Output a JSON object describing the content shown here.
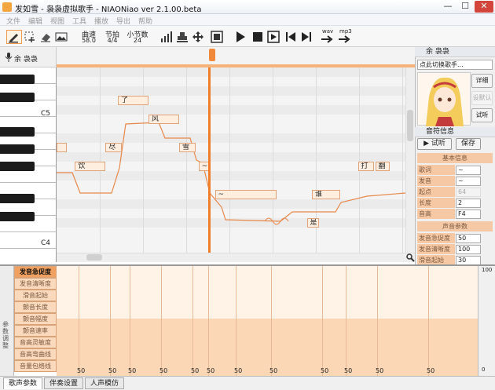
{
  "window": {
    "title": "发如雪 - 袅袅虚拟歌手 - NIAONiao ver 2.1.00.beta",
    "min": "—",
    "max": "☐",
    "close": "✕"
  },
  "menu": [
    "文件",
    "编辑",
    "视图",
    "工具",
    "播放",
    "导出",
    "帮助"
  ],
  "params": {
    "tempo_label": "曲速",
    "tempo_value": "58.0",
    "beat_label": "节拍",
    "beat_value": "4/4",
    "measures_label": "小节数",
    "measures_value": "24"
  },
  "export": {
    "wav": "wav",
    "mp3": "mp3"
  },
  "track": {
    "name": "余 袅袅"
  },
  "piano": {
    "c5": "C5",
    "c4": "C4"
  },
  "notes": [
    {
      "lyric": "",
      "start": 0.0,
      "len": 1.0,
      "pitch": 67
    },
    {
      "lyric": "了",
      "start": 6.0,
      "len": 3.0,
      "pitch": 72
    },
    {
      "lyric": "风",
      "start": 9.0,
      "len": 3.0,
      "pitch": 70
    },
    {
      "lyric": "尽",
      "start": 4.8,
      "len": 1.6,
      "pitch": 67
    },
    {
      "lyric": "雪",
      "start": 12.0,
      "len": 1.6,
      "pitch": 67
    },
    {
      "lyric": "饮",
      "start": 1.8,
      "len": 3.0,
      "pitch": 65
    },
    {
      "lyric": "~",
      "start": 13.9,
      "len": 1.0,
      "pitch": 65
    },
    {
      "lyric": "~",
      "start": 15.5,
      "len": 6.0,
      "pitch": 62
    },
    {
      "lyric": "谁",
      "start": 25.0,
      "len": 2.8,
      "pitch": 62
    },
    {
      "lyric": "打",
      "start": 29.5,
      "len": 1.6,
      "pitch": 65
    },
    {
      "lyric": "翻",
      "start": 31.2,
      "len": 1.4,
      "pitch": 65
    },
    {
      "lyric": "是",
      "start": 24.5,
      "len": 1.2,
      "pitch": 59
    }
  ],
  "right_panel": {
    "singer_header": "余 袅袅",
    "singer_select": "点此切换歌手...",
    "btn_detail": "详细",
    "btn_default": "设默认",
    "btn_audition": "试听",
    "note_info": "音符信息",
    "play_audition": "▶ 试听",
    "save": "保存",
    "basic_info": "基本信息",
    "fields": [
      {
        "label": "歌词",
        "value": "~",
        "disabled": false
      },
      {
        "label": "发音",
        "value": "~",
        "disabled": false
      },
      {
        "label": "起点",
        "value": "64",
        "disabled": true
      },
      {
        "label": "长度",
        "value": "2",
        "disabled": false
      },
      {
        "label": "音高",
        "value": "F4",
        "disabled": false
      }
    ],
    "voice_params": "声音参数",
    "voice_fields": [
      {
        "label": "发音急促度",
        "value": "50"
      },
      {
        "label": "发音清晰度",
        "value": "100"
      },
      {
        "label": "滑音起始",
        "value": "30"
      }
    ]
  },
  "lower": {
    "side_label": "参数调整",
    "items": [
      "发音急促度",
      "发音清晰度",
      "滑音起始",
      "颤音长度",
      "颤音幅度",
      "颤音速率",
      "音高灵敏度",
      "音高弯曲线",
      "音量包络线"
    ],
    "values": [
      50,
      50,
      50,
      50,
      50,
      50,
      50,
      50,
      50,
      50,
      50,
      50
    ],
    "scale_top": "100",
    "scale_bottom": "0"
  },
  "tabs": [
    "歌声参数",
    "伴奏设置",
    "人声模仿"
  ]
}
